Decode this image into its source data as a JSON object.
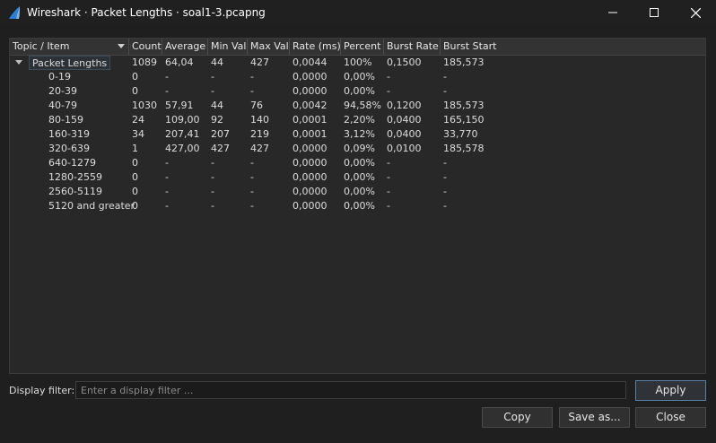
{
  "window": {
    "title": "Wireshark · Packet Lengths · soal1-3.pcapng",
    "minimize_icon": "minimize-icon",
    "maximize_icon": "maximize-icon",
    "close_icon": "close-icon"
  },
  "table": {
    "columns": [
      "Topic / Item",
      "Count",
      "Average",
      "Min Val",
      "Max Val",
      "Rate (ms)",
      "Percent",
      "Burst Rate",
      "Burst Start"
    ],
    "root": [
      "Packet Lengths",
      "1089",
      "64,04",
      "44",
      "427",
      "0,0044",
      "100%",
      "0,1500",
      "185,573"
    ],
    "rows": [
      [
        "0-19",
        "0",
        "-",
        "-",
        "-",
        "0,0000",
        "0,00%",
        "-",
        "-"
      ],
      [
        "20-39",
        "0",
        "-",
        "-",
        "-",
        "0,0000",
        "0,00%",
        "-",
        "-"
      ],
      [
        "40-79",
        "1030",
        "57,91",
        "44",
        "76",
        "0,0042",
        "94,58%",
        "0,1200",
        "185,573"
      ],
      [
        "80-159",
        "24",
        "109,00",
        "92",
        "140",
        "0,0001",
        "2,20%",
        "0,0400",
        "165,150"
      ],
      [
        "160-319",
        "34",
        "207,41",
        "207",
        "219",
        "0,0001",
        "3,12%",
        "0,0400",
        "33,770"
      ],
      [
        "320-639",
        "1",
        "427,00",
        "427",
        "427",
        "0,0000",
        "0,09%",
        "0,0100",
        "185,578"
      ],
      [
        "640-1279",
        "0",
        "-",
        "-",
        "-",
        "0,0000",
        "0,00%",
        "-",
        "-"
      ],
      [
        "1280-2559",
        "0",
        "-",
        "-",
        "-",
        "0,0000",
        "0,00%",
        "-",
        "-"
      ],
      [
        "2560-5119",
        "0",
        "-",
        "-",
        "-",
        "0,0000",
        "0,00%",
        "-",
        "-"
      ],
      [
        "5120 and greater",
        "0",
        "-",
        "-",
        "-",
        "0,0000",
        "0,00%",
        "-",
        "-"
      ]
    ]
  },
  "filter": {
    "label": "Display filter:",
    "placeholder": "Enter a display filter ...",
    "value": ""
  },
  "buttons": {
    "apply": "Apply",
    "copy": "Copy",
    "save_as": "Save as...",
    "close": "Close"
  },
  "colors": {
    "background": "#1f1f1f",
    "tree_background": "#282828",
    "accent": "#5a7fa6"
  }
}
